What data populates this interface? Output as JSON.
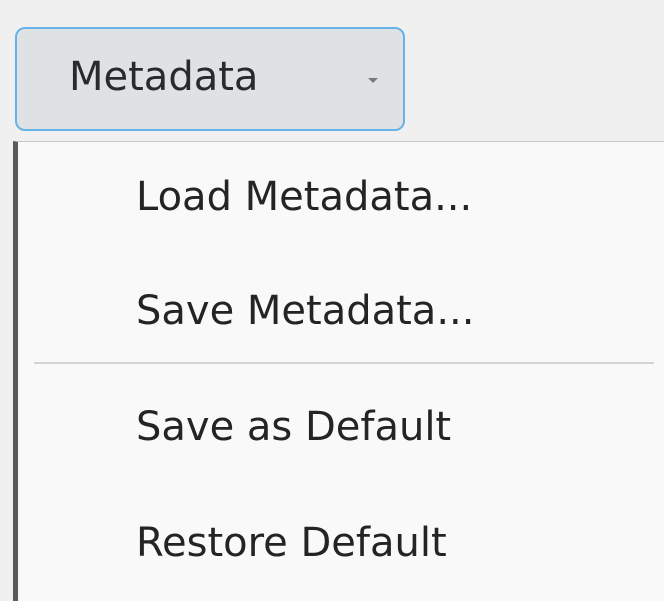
{
  "dropdown": {
    "label": "Metadata",
    "arrow_icon": "dropdown-arrow-icon"
  },
  "menu": {
    "items": [
      {
        "label": "Load Metadata..."
      },
      {
        "label": "Save Metadata..."
      },
      {
        "label": "Save as Default"
      },
      {
        "label": "Restore Default"
      }
    ]
  },
  "colors": {
    "button_border": "#67b2e6",
    "button_background": "#dfe2e5",
    "menu_background": "#f9f9f9",
    "separator": "#d2d2d2",
    "text": "#242424"
  }
}
